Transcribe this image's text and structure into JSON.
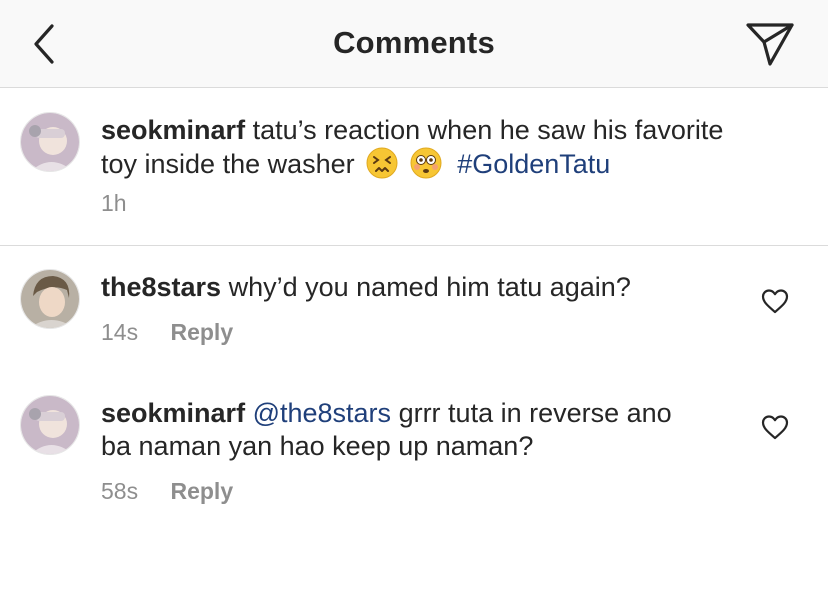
{
  "header": {
    "title": "Comments",
    "back_icon": "chevron-left-icon",
    "share_icon": "paper-plane-icon"
  },
  "caption": {
    "username": "seokminarf",
    "text_line1": "tatu’s reaction when he saw his favorite",
    "text_line2": "toy inside the washer",
    "emojis": [
      "persevering-face-emoji",
      "flushed-face-emoji"
    ],
    "hashtag": "#GoldenTatu",
    "time": "1h"
  },
  "comments": [
    {
      "username": "the8stars",
      "text": "why’d you named him tatu again?",
      "time": "14s",
      "reply_label": "Reply"
    },
    {
      "username": "seokminarf",
      "mention": "@the8stars",
      "text_line1": "grrr tuta in reverse ano",
      "text_line2": "ba naman yan hao keep up naman?",
      "time": "58s",
      "reply_label": "Reply"
    }
  ],
  "colors": {
    "link": "#1f3f7a",
    "muted": "#8e8e8e",
    "text": "#262626",
    "header_bg": "#f9f9f9"
  }
}
